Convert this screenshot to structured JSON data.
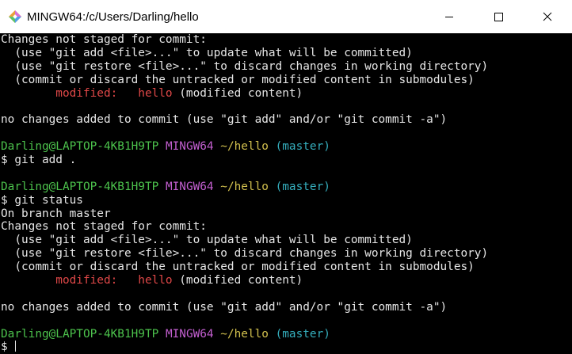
{
  "window": {
    "title": "MINGW64:/c/Users/Darling/hello"
  },
  "terminal": {
    "lines": [
      [
        {
          "t": "Changes not staged for commit:",
          "c": ""
        }
      ],
      [
        {
          "t": "  (use \"git add <file>...\" to update what will be committed)",
          "c": ""
        }
      ],
      [
        {
          "t": "  (use \"git restore <file>...\" to discard changes in working directory)",
          "c": ""
        }
      ],
      [
        {
          "t": "  (commit or discard the untracked or modified content in submodules)",
          "c": ""
        }
      ],
      [
        {
          "t": "        modified:   hello",
          "c": "red"
        },
        {
          "t": " (modified content)",
          "c": ""
        }
      ],
      [
        {
          "t": "",
          "c": ""
        }
      ],
      [
        {
          "t": "no changes added to commit (use \"git add\" and/or \"git commit -a\")",
          "c": ""
        }
      ],
      [
        {
          "t": "",
          "c": ""
        }
      ],
      [
        {
          "t": "Darling@LAPTOP-4KB1H9TP",
          "c": "green"
        },
        {
          "t": " ",
          "c": ""
        },
        {
          "t": "MINGW64",
          "c": "magenta"
        },
        {
          "t": " ",
          "c": ""
        },
        {
          "t": "~/hello",
          "c": "yellow"
        },
        {
          "t": " ",
          "c": ""
        },
        {
          "t": "(master)",
          "c": "cyan"
        }
      ],
      [
        {
          "t": "$ git add .",
          "c": ""
        }
      ],
      [
        {
          "t": "",
          "c": ""
        }
      ],
      [
        {
          "t": "Darling@LAPTOP-4KB1H9TP",
          "c": "green"
        },
        {
          "t": " ",
          "c": ""
        },
        {
          "t": "MINGW64",
          "c": "magenta"
        },
        {
          "t": " ",
          "c": ""
        },
        {
          "t": "~/hello",
          "c": "yellow"
        },
        {
          "t": " ",
          "c": ""
        },
        {
          "t": "(master)",
          "c": "cyan"
        }
      ],
      [
        {
          "t": "$ git status",
          "c": ""
        }
      ],
      [
        {
          "t": "On branch master",
          "c": ""
        }
      ],
      [
        {
          "t": "Changes not staged for commit:",
          "c": ""
        }
      ],
      [
        {
          "t": "  (use \"git add <file>...\" to update what will be committed)",
          "c": ""
        }
      ],
      [
        {
          "t": "  (use \"git restore <file>...\" to discard changes in working directory)",
          "c": ""
        }
      ],
      [
        {
          "t": "  (commit or discard the untracked or modified content in submodules)",
          "c": ""
        }
      ],
      [
        {
          "t": "        modified:   hello",
          "c": "red"
        },
        {
          "t": " (modified content)",
          "c": ""
        }
      ],
      [
        {
          "t": "",
          "c": ""
        }
      ],
      [
        {
          "t": "no changes added to commit (use \"git add\" and/or \"git commit -a\")",
          "c": ""
        }
      ],
      [
        {
          "t": "",
          "c": ""
        }
      ],
      [
        {
          "t": "Darling@LAPTOP-4KB1H9TP",
          "c": "green"
        },
        {
          "t": " ",
          "c": ""
        },
        {
          "t": "MINGW64",
          "c": "magenta"
        },
        {
          "t": " ",
          "c": ""
        },
        {
          "t": "~/hello",
          "c": "yellow"
        },
        {
          "t": " ",
          "c": ""
        },
        {
          "t": "(master)",
          "c": "cyan"
        }
      ]
    ],
    "prompt": "$ "
  },
  "colors": {
    "background": "#000000",
    "foreground": "#e6e6e6",
    "red": "#e04848",
    "green": "#4cc24c",
    "magenta": "#c35fd0",
    "yellow": "#d2c04e",
    "cyan": "#35aebd"
  },
  "icons": {
    "app": "git-bash-diamond-icon",
    "minimize": "minimize-icon",
    "maximize": "maximize-icon",
    "close": "close-icon"
  }
}
